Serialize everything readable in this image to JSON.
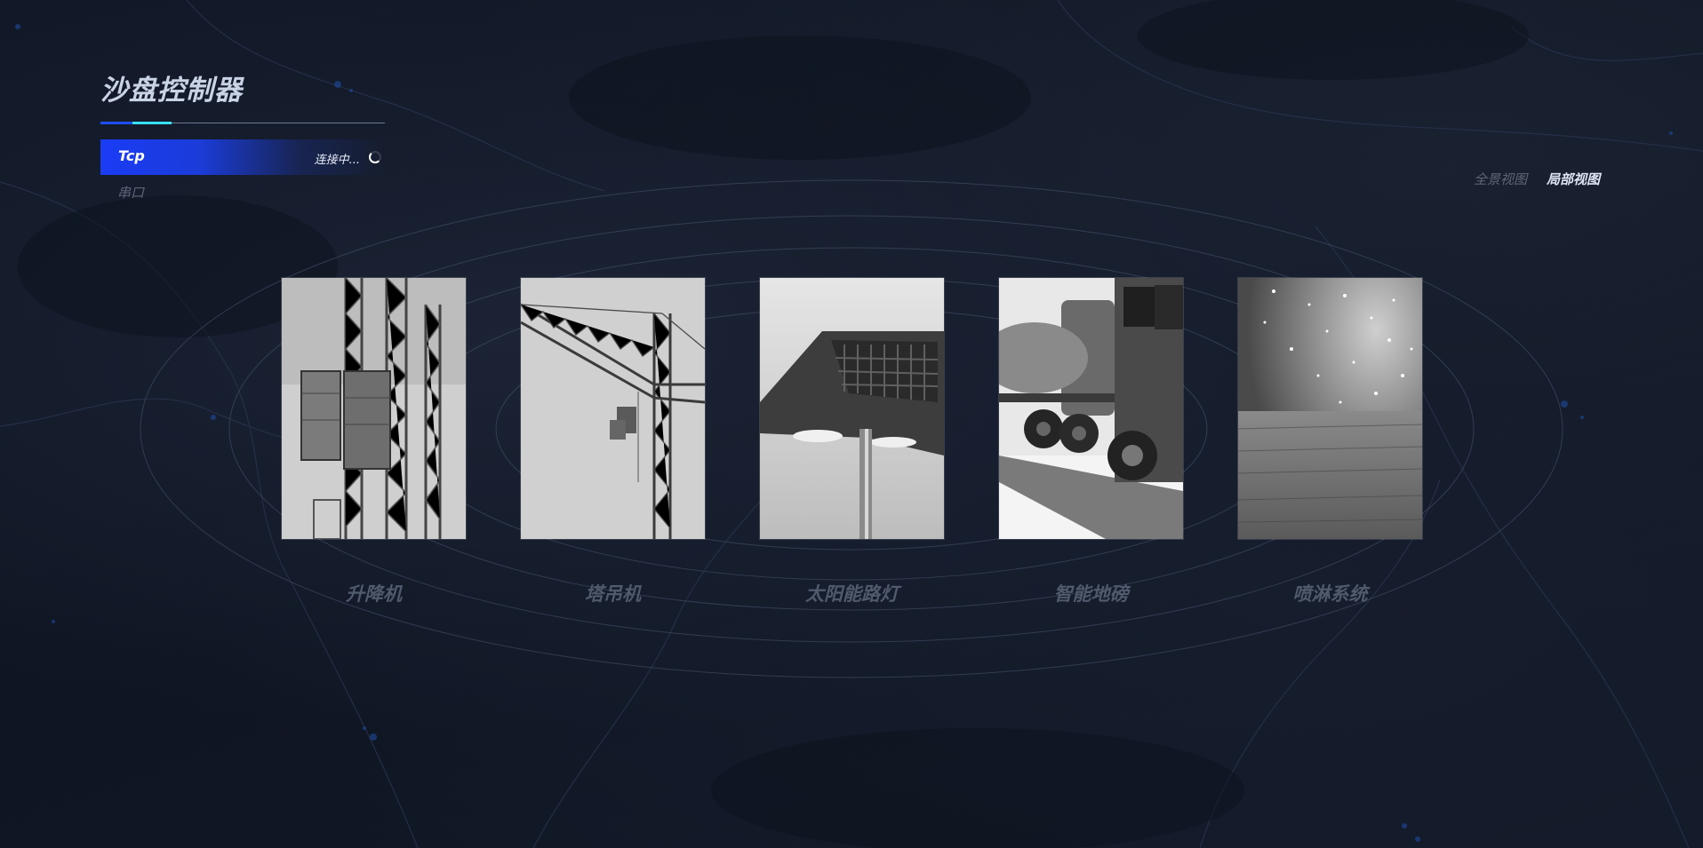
{
  "header": {
    "title": "沙盘控制器"
  },
  "connection": {
    "active_tab": "Tcp",
    "status": "连接中...",
    "other_tab": "串口"
  },
  "view_tabs": {
    "panorama": "全景视图",
    "local": "局部视图",
    "selected": "局部视图"
  },
  "devices": [
    {
      "label": "升降机",
      "image": "construction-hoist-photo"
    },
    {
      "label": "塔吊机",
      "image": "tower-crane-photo"
    },
    {
      "label": "太阳能路灯",
      "image": "solar-street-lamp-photo"
    },
    {
      "label": "智能地磅",
      "image": "truck-scale-photo"
    },
    {
      "label": "喷淋系统",
      "image": "sprinkler-mist-photo"
    }
  ],
  "colors": {
    "background": "#111725",
    "accent_blue": "#1a3cf5",
    "accent_cyan": "#38e0ff",
    "title_text": "#c9d3e6",
    "muted_text": "#4f5a6c"
  }
}
